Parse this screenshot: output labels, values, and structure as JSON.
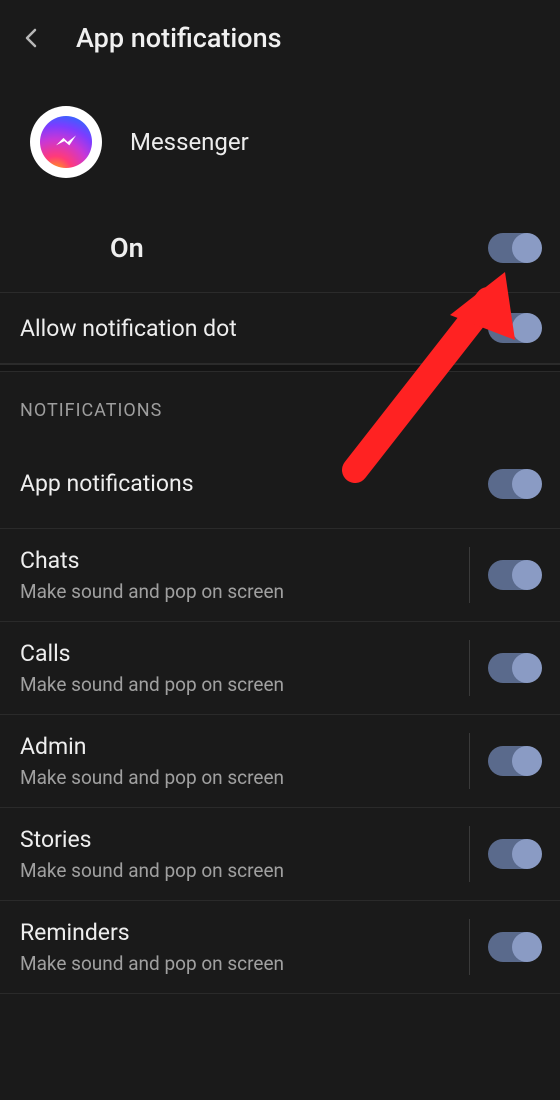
{
  "header": {
    "title": "App notifications"
  },
  "app": {
    "name": "Messenger"
  },
  "master": {
    "label": "On",
    "enabled": true
  },
  "dot": {
    "label": "Allow notification dot",
    "enabled": true
  },
  "section_header": "NOTIFICATIONS",
  "items": [
    {
      "title": "App notifications",
      "sub": "",
      "enabled": true,
      "divider": false
    },
    {
      "title": "Chats",
      "sub": "Make sound and pop on screen",
      "enabled": true,
      "divider": true
    },
    {
      "title": "Calls",
      "sub": "Make sound and pop on screen",
      "enabled": true,
      "divider": true
    },
    {
      "title": "Admin",
      "sub": "Make sound and pop on screen",
      "enabled": true,
      "divider": true
    },
    {
      "title": "Stories",
      "sub": "Make sound and pop on screen",
      "enabled": true,
      "divider": true
    },
    {
      "title": "Reminders",
      "sub": "Make sound and pop on screen",
      "enabled": true,
      "divider": true
    }
  ]
}
